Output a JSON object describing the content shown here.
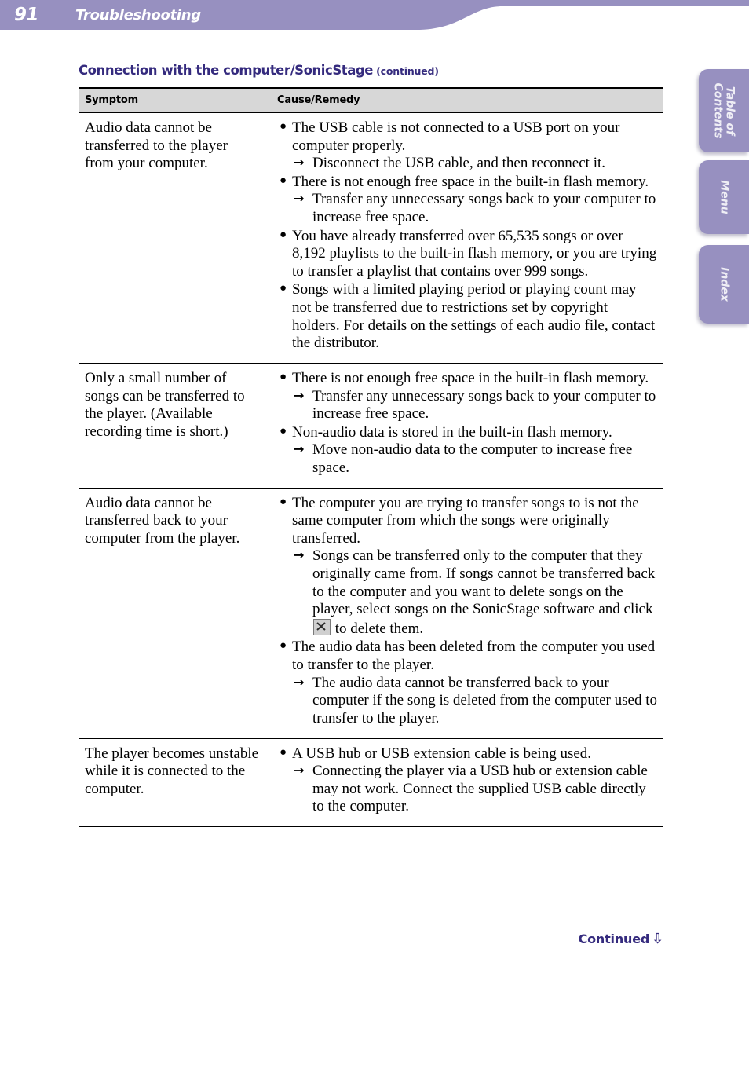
{
  "header": {
    "page_number": "91",
    "title": "Troubleshooting",
    "band_color": "#9790c0"
  },
  "side_tabs": [
    {
      "name": "table-of-contents",
      "label_line1": "Table of",
      "label_line2": "Contents"
    },
    {
      "name": "menu",
      "label_line1": "Menu",
      "label_line2": ""
    },
    {
      "name": "index",
      "label_line1": "Index",
      "label_line2": ""
    }
  ],
  "section": {
    "heading": "Connection with the computer/SonicStage",
    "heading_suffix": "(continued)",
    "heading_color": "#352b7e"
  },
  "table": {
    "columns": [
      "Symptom",
      "Cause/Remedy"
    ],
    "rows": [
      {
        "symptom": "Audio data cannot be transferred to the player from your computer.",
        "causes": [
          {
            "cause": "The USB cable is not connected to a USB port on your computer properly.",
            "remedy": "Disconnect the USB cable, and then reconnect it."
          },
          {
            "cause": "There is not enough free space in the built-in flash memory.",
            "remedy": "Transfer any unnecessary songs back to your computer to increase free space."
          },
          {
            "cause": "You have already transferred over 65,535 songs or over 8,192 playlists to the built-in flash memory, or you are trying to transfer a playlist that contains over 999 songs.",
            "remedy": ""
          },
          {
            "cause": "Songs with a limited playing period or playing count may not be transferred due to restrictions set by copyright holders. For details on the settings of each audio file, contact the distributor.",
            "remedy": ""
          }
        ]
      },
      {
        "symptom": "Only a small number of songs can be transferred to the player. (Available recording time is short.)",
        "causes": [
          {
            "cause": "There is not enough free space in the built-in flash memory.",
            "remedy": "Transfer any unnecessary songs back to your computer to increase free space."
          },
          {
            "cause": "Non-audio data is stored in the built-in flash memory.",
            "remedy": "Move non-audio data to the computer to increase free space."
          }
        ]
      },
      {
        "symptom": "Audio data cannot be transferred back to your computer from the player.",
        "causes": [
          {
            "cause": "The computer you are trying to transfer songs to is not the same computer from which the songs were originally transferred.",
            "remedy_part1": "Songs can be transferred only to the computer that they originally came from. If songs cannot be transferred back to the computer and you want to delete songs on the player, select songs on the SonicStage software and click",
            "remedy_icon": "delete-x-icon",
            "remedy_part2": "to delete them."
          },
          {
            "cause": "The audio data has been deleted from the computer you used to transfer to the player.",
            "remedy": "The audio data cannot be transferred back to your computer if the song is deleted from the computer used to transfer to the player."
          }
        ]
      },
      {
        "symptom": "The player becomes unstable while it is connected to the computer.",
        "causes": [
          {
            "cause": "A USB hub or USB extension cable is being used.",
            "remedy": "Connecting the player via a USB hub or extension cable may not work. Connect the supplied USB cable directly to the computer."
          }
        ]
      }
    ]
  },
  "footer": {
    "continued_label": "Continued",
    "arrow_glyph": "⇩"
  },
  "glyphs": {
    "bullet": "●",
    "arrow_right": "→"
  }
}
